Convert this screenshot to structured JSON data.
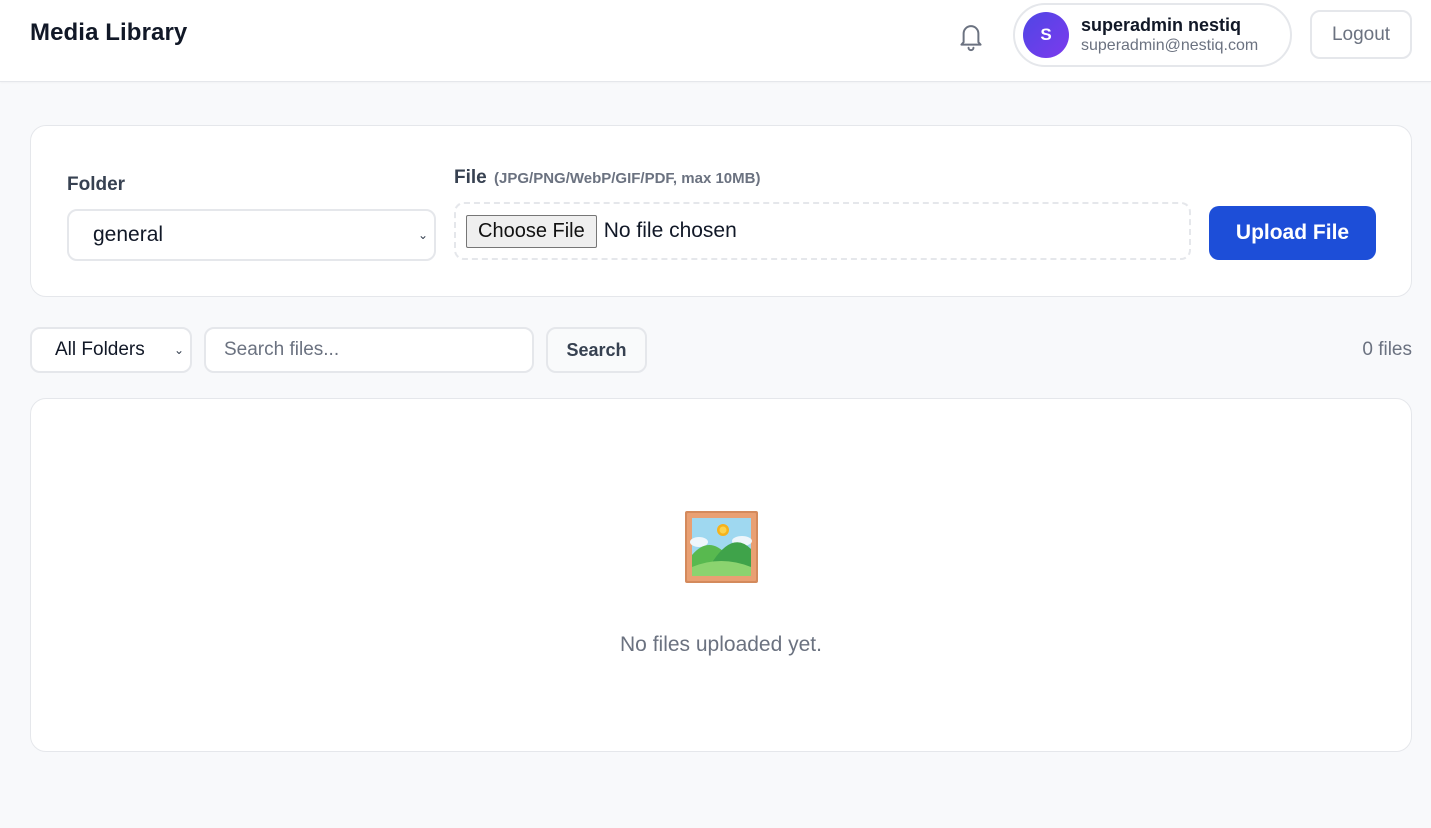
{
  "header": {
    "title": "Media Library",
    "user": {
      "initial": "S",
      "name": "superadmin nestiq",
      "email": "superadmin@nestiq.com"
    },
    "logout_label": "Logout"
  },
  "upload": {
    "folder_label": "Folder",
    "folder_value": "general",
    "file_label": "File",
    "file_hint": "(JPG/PNG/WebP/GIF/PDF, max 10MB)",
    "choose_label": "Choose File",
    "no_file_text": "No file chosen",
    "upload_label": "Upload File"
  },
  "filters": {
    "folder_value": "All Folders",
    "search_placeholder": "Search files...",
    "search_label": "Search",
    "count_text": "0 files"
  },
  "empty_state": {
    "icon": "framed-picture-icon",
    "text": "No files uploaded yet."
  },
  "colors": {
    "primary": "#1d4ed8",
    "avatar_gradient_start": "#4f46e5",
    "avatar_gradient_end": "#7c3aed"
  }
}
